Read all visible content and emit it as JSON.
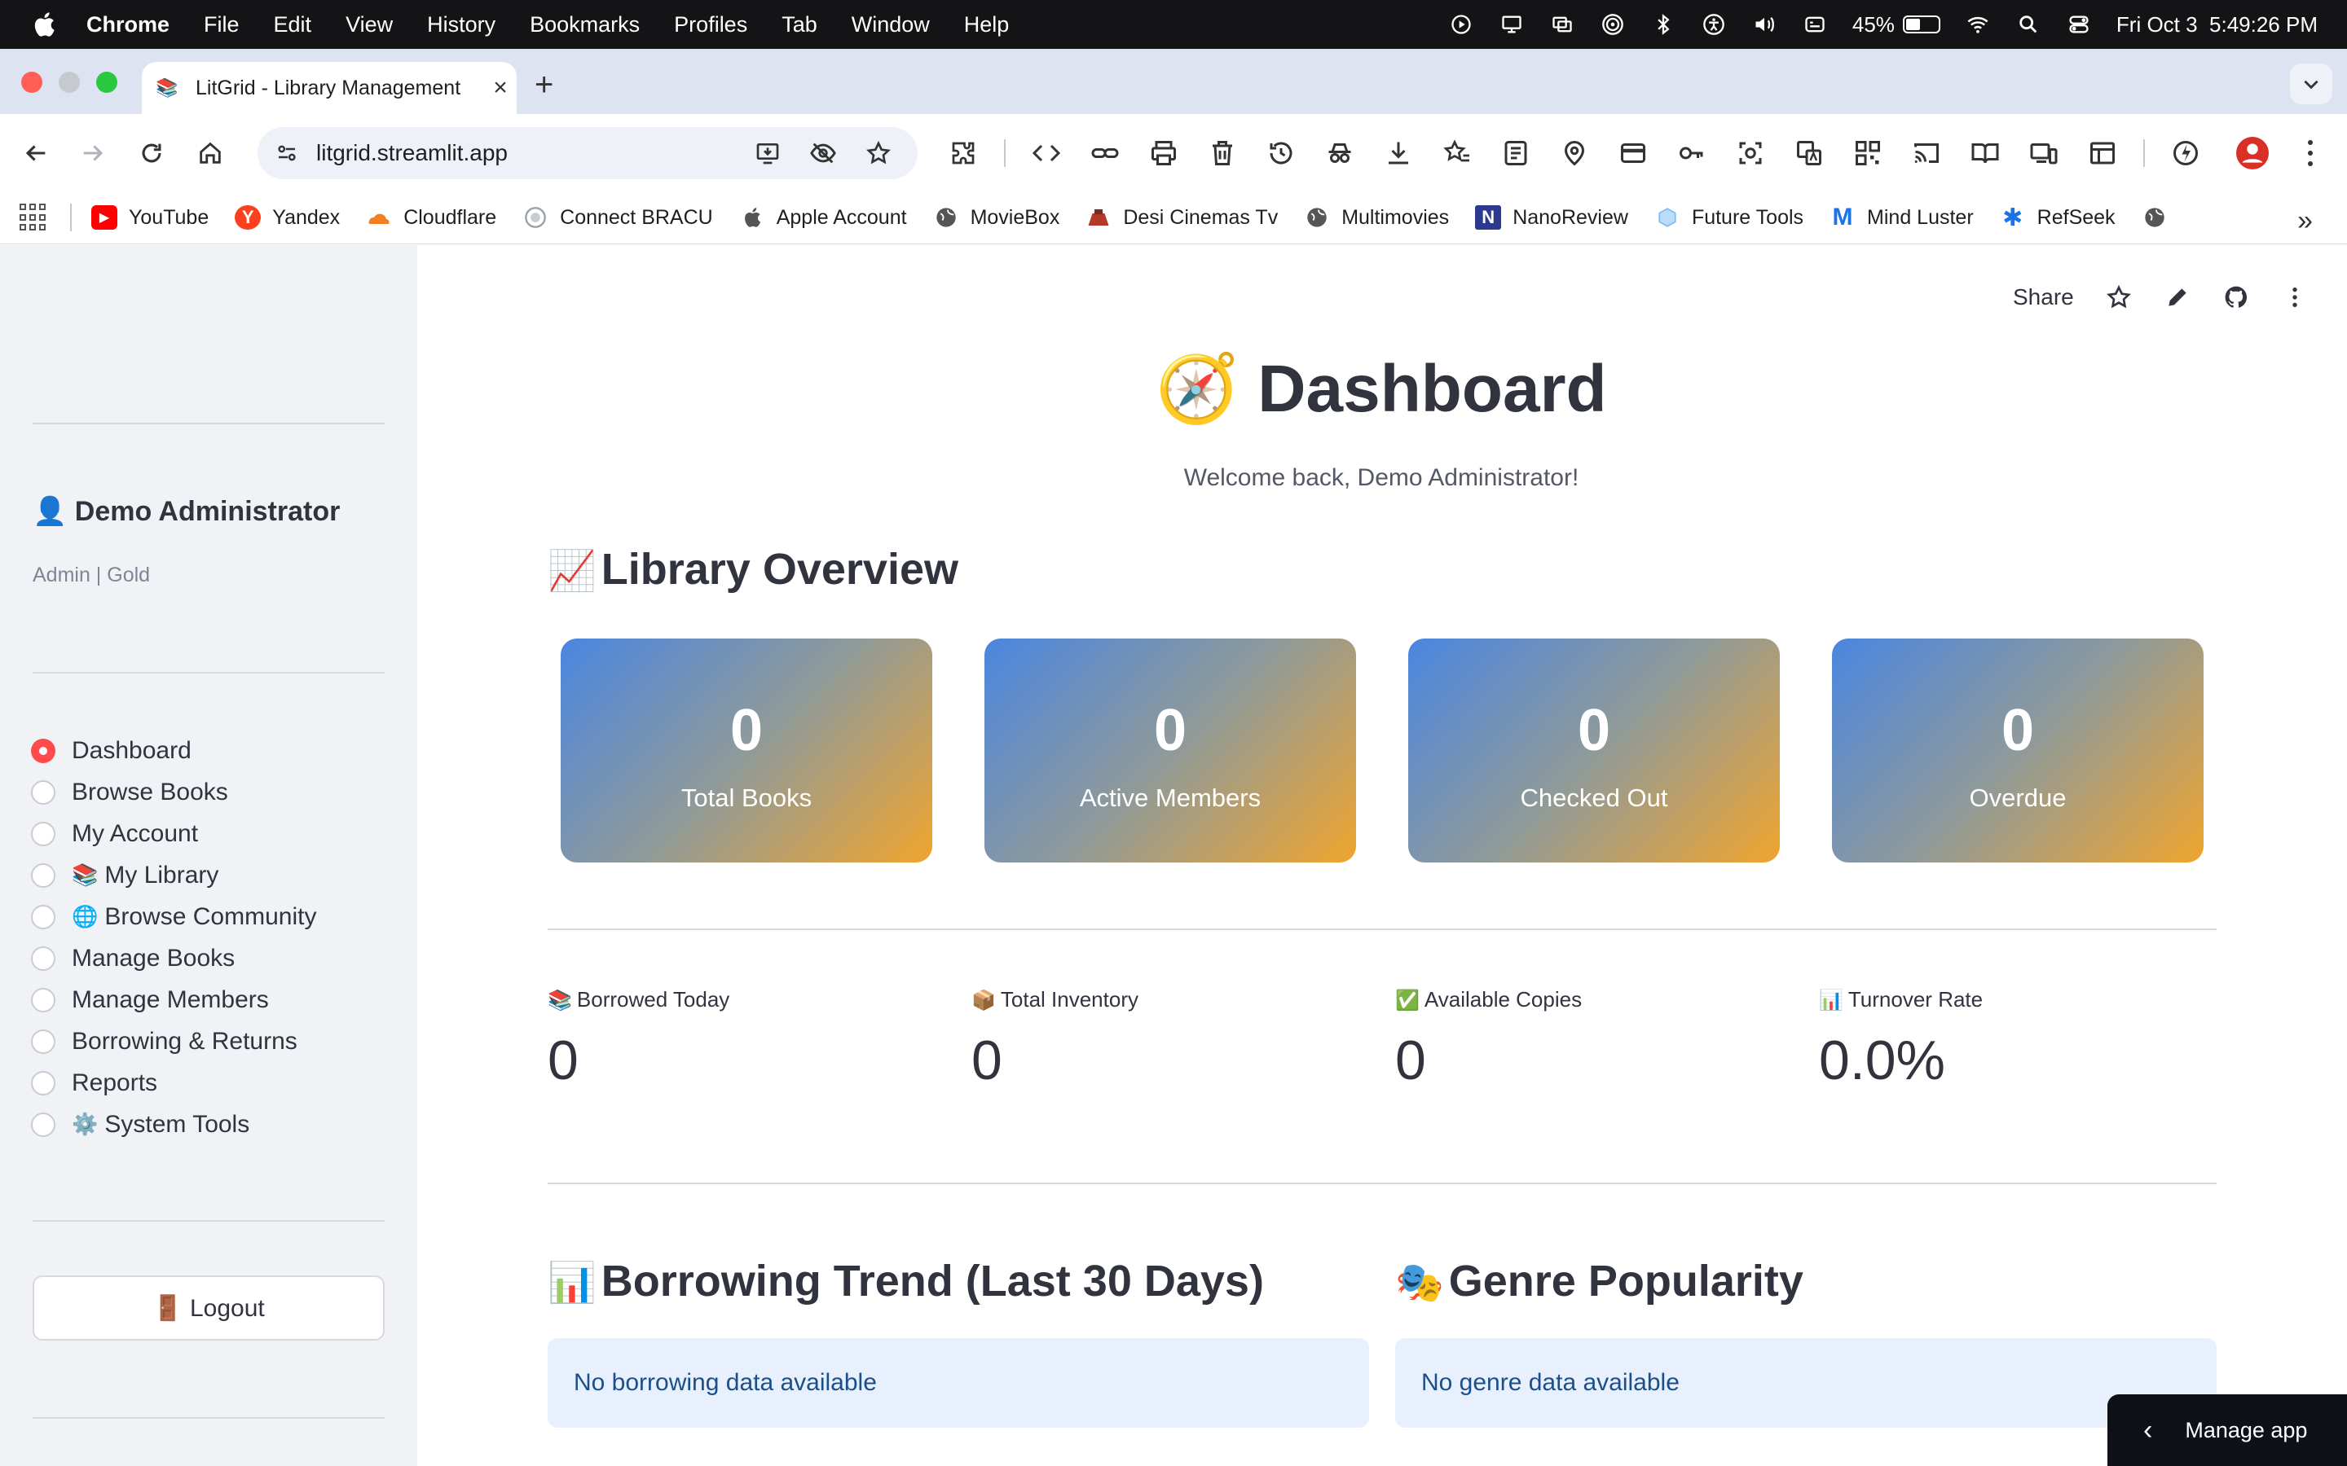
{
  "menubar": {
    "app": "Chrome",
    "items": [
      "File",
      "Edit",
      "View",
      "History",
      "Bookmarks",
      "Profiles",
      "Tab",
      "Window",
      "Help"
    ],
    "battery_percent": "45%",
    "battery_level": 0.45,
    "datetime": "Fri Oct 3  5:49:26 PM"
  },
  "browser": {
    "tab_title": "LitGrid - Library Management",
    "tab_favicon": "📚",
    "new_tab": "+",
    "url": "litgrid.streamlit.app",
    "bookmarks": [
      {
        "label": "YouTube",
        "icon": "youtube-icon",
        "color": "#ff0000"
      },
      {
        "label": "Yandex",
        "icon": "yandex-icon",
        "color": "#fc3f1d"
      },
      {
        "label": "Cloudflare",
        "icon": "cloudflare-icon",
        "color": "#f38020"
      },
      {
        "label": "Connect BRACU",
        "icon": "bracu-icon",
        "color": "#9aa0a6"
      },
      {
        "label": "Apple Account",
        "icon": "apple-icon",
        "color": "#333333"
      },
      {
        "label": "MovieBox",
        "icon": "globe-icon",
        "color": "#555555"
      },
      {
        "label": "Desi Cinemas Tv",
        "icon": "desi-icon",
        "color": "#b33a2b"
      },
      {
        "label": "Multimovies",
        "icon": "globe-icon",
        "color": "#555555"
      },
      {
        "label": "NanoReview",
        "icon": "nanoreview-icon",
        "color": "#2b3a8f"
      },
      {
        "label": "Future Tools",
        "icon": "futuretools-icon",
        "color": "#7ab8f5"
      },
      {
        "label": "Mind Luster",
        "icon": "mindluster-icon",
        "color": "#1a73e8"
      },
      {
        "label": "RefSeek",
        "icon": "refseek-icon",
        "color": "#1a73e8"
      }
    ]
  },
  "sidebar": {
    "user_name": "👤 Demo Administrator",
    "user_role": "Admin | Gold",
    "nav": [
      {
        "emoji": "",
        "label": "Dashboard",
        "active": true
      },
      {
        "emoji": "",
        "label": "Browse Books",
        "active": false
      },
      {
        "emoji": "",
        "label": "My Account",
        "active": false
      },
      {
        "emoji": "📚",
        "label": "My Library",
        "active": false
      },
      {
        "emoji": "🌐",
        "label": "Browse Community",
        "active": false
      },
      {
        "emoji": "",
        "label": "Manage Books",
        "active": false
      },
      {
        "emoji": "",
        "label": "Manage Members",
        "active": false
      },
      {
        "emoji": "",
        "label": "Borrowing & Returns",
        "active": false
      },
      {
        "emoji": "",
        "label": "Reports",
        "active": false
      },
      {
        "emoji": "⚙️",
        "label": "System Tools",
        "active": false
      }
    ],
    "logout": "🚪 Logout"
  },
  "header": {
    "share": "Share"
  },
  "main": {
    "title": "🧭 Dashboard",
    "welcome": "Welcome back, Demo Administrator!",
    "overview_title": "Library Overview",
    "overview_emoji": "📈",
    "cards": [
      {
        "value": "0",
        "label": "Total Books"
      },
      {
        "value": "0",
        "label": "Active Members"
      },
      {
        "value": "0",
        "label": "Checked Out"
      },
      {
        "value": "0",
        "label": "Overdue"
      }
    ],
    "metrics": [
      {
        "emoji": "📚",
        "label": "Borrowed Today",
        "value": "0"
      },
      {
        "emoji": "📦",
        "label": "Total Inventory",
        "value": "0"
      },
      {
        "emoji": "✅",
        "label": "Available Copies",
        "value": "0"
      },
      {
        "emoji": "📊",
        "label": "Turnover Rate",
        "value": "0.0%"
      }
    ],
    "trend_title": "Borrowing Trend (Last 30 Days)",
    "trend_emoji": "📊",
    "trend_empty": "No borrowing data available",
    "genre_title": "Genre Popularity",
    "genre_emoji": "🎭",
    "genre_empty": "No genre data available"
  },
  "manage_app": "Manage app"
}
